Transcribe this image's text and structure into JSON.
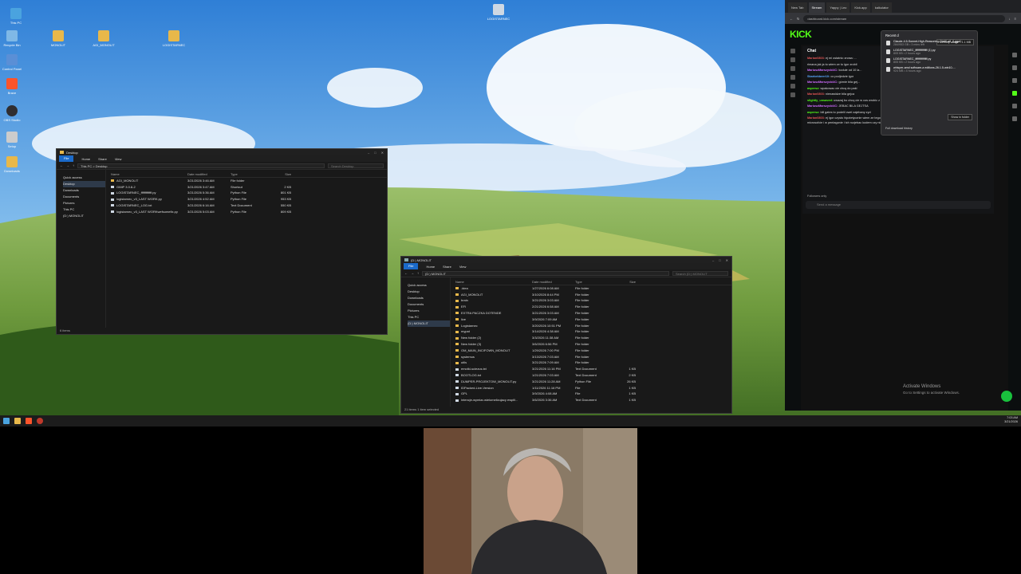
{
  "desktop": {
    "icons": [
      {
        "label": "This PC",
        "color": "#4aa3df"
      },
      {
        "label": "Recycle Bin",
        "color": "#7fb8e6"
      },
      {
        "label": "Control Panel",
        "color": "#5a8fd6"
      },
      {
        "label": "Brave",
        "color": "#fb542b"
      },
      {
        "label": "OBS Studio",
        "color": "#302e31"
      },
      {
        "label": "Setup",
        "color": "#cccccc"
      },
      {
        "label": "Downloads",
        "color": "#e8b84a"
      },
      {
        "label": "MONOLIT",
        "color": "#e8b84a"
      },
      {
        "label": "AGI_MONOLIT",
        "color": "#e8b84a"
      },
      {
        "label": "LOGISTARNEC",
        "color": "#e8b84a"
      },
      {
        "label": "LOGISTARNEC",
        "color": "#cfd8e3"
      }
    ]
  },
  "explorer_desktop": {
    "title": "Desktop",
    "ribbon": [
      "File",
      "Home",
      "Share",
      "View"
    ],
    "address": "This PC  >  Desktop",
    "search_placeholder": "Search Desktop",
    "nav": [
      "Quick access",
      "Desktop",
      "Downloads",
      "Documents",
      "Pictures",
      "This PC",
      "(D:) MONOLIT"
    ],
    "columns": [
      "Name",
      "Date modified",
      "Type",
      "Size"
    ],
    "rows": [
      {
        "name": "AGI_MONOLIT",
        "date": "3/21/2026 3:46 AM",
        "type": "File folder",
        "size": "",
        "kind": "folder"
      },
      {
        "name": "GIMP 3.0.8-2",
        "date": "3/21/2026 3:47 AM",
        "type": "Shortcut",
        "size": "2 KB",
        "kind": "doc"
      },
      {
        "name": "LOGISTARNEC_fffffffffffff.py",
        "date": "3/21/2026 5:36 AM",
        "type": "Python File",
        "size": "801 KB",
        "kind": "doc"
      },
      {
        "name": "logistarnec_v3_LAST WORK.py",
        "date": "3/21/2026 4:52 AM",
        "type": "Python File",
        "size": "953 KB",
        "kind": "doc"
      },
      {
        "name": "LOGISTARNEC_LOG.txt",
        "date": "3/21/2026 6:16 AM",
        "type": "Text Document",
        "size": "550 KB",
        "kind": "doc"
      },
      {
        "name": "logistarnec_v3_LAST WORKwefsomefix.py",
        "date": "3/21/2026 5:03 AM",
        "type": "Python File",
        "size": "809 KB",
        "kind": "doc"
      }
    ],
    "status": "6 items"
  },
  "explorer_monolit": {
    "title": "(D:) MONOLIT",
    "ribbon": [
      "File",
      "Home",
      "Share",
      "View"
    ],
    "address": "(D:) MONOLIT",
    "search_placeholder": "Search (D:) MONOLIT",
    "nav": [
      "Quick access",
      "Desktop",
      "Downloads",
      "Documents",
      "Pictures",
      "This PC",
      "(D:) MONOLIT"
    ],
    "columns": [
      "Name",
      "Date modified",
      "Type",
      "Size"
    ],
    "rows": [
      {
        "name": ".idea",
        "date": "1/27/2026 6:08 AM",
        "type": "File folder",
        "size": "",
        "kind": "folder"
      },
      {
        "name": "AGI_MONOLIT",
        "date": "3/10/2026 8:44 PM",
        "type": "File folder",
        "size": "",
        "kind": "folder"
      },
      {
        "name": "brain",
        "date": "3/21/2026 3:03 AM",
        "type": "File folder",
        "size": "",
        "kind": "folder"
      },
      {
        "name": "EFI",
        "date": "2/21/2026 6:58 AM",
        "type": "File folder",
        "size": "",
        "kind": "folder"
      },
      {
        "name": "EXTRA PACZKA DOTENDE",
        "date": "3/21/2026 3:03 AM",
        "type": "File folder",
        "size": "",
        "kind": "folder"
      },
      {
        "name": "live",
        "date": "3/9/2026 7:09 AM",
        "type": "File folder",
        "size": "",
        "kind": "folder"
      },
      {
        "name": "Logistarnec",
        "date": "3/20/2026 10:51 PM",
        "type": "File folder",
        "size": "",
        "kind": "folder"
      },
      {
        "name": "mypat",
        "date": "3/14/2026 4:38 AM",
        "type": "File folder",
        "size": "",
        "kind": "folder"
      },
      {
        "name": "New folder (2)",
        "date": "3/3/2026 11:38 AM",
        "type": "File folder",
        "size": "",
        "kind": "folder"
      },
      {
        "name": "New folder (3)",
        "date": "3/6/2026 6:56 PM",
        "type": "File folder",
        "size": "",
        "kind": "folder"
      },
      {
        "name": "OM_MAIN_INCIFOWN_MONOLIT",
        "date": "1/29/2026 7:00 PM",
        "type": "File folder",
        "size": "",
        "kind": "folder"
      },
      {
        "name": "systemus",
        "date": "3/13/2026 7:03 AM",
        "type": "File folder",
        "size": "",
        "kind": "folder"
      },
      {
        "name": "utils",
        "date": "3/21/2026 7:09 AM",
        "type": "File folder",
        "size": "",
        "kind": "folder"
      },
      {
        "name": "emotki-sciezus.txt",
        "date": "3/21/2026 11:16 PM",
        "type": "Text Document",
        "size": "1 KB",
        "kind": "doc"
      },
      {
        "name": "BOOTLOG.txt",
        "date": "1/21/2026 7:03 AM",
        "type": "Text Document",
        "size": "2 KB",
        "kind": "doc"
      },
      {
        "name": "DUMPER-PROJEKTOW_MONOLIT.py",
        "date": "3/21/2026 11:28 AM",
        "type": "Python File",
        "size": "26 KB",
        "kind": "doc"
      },
      {
        "name": "IDPacked-Live-Version",
        "date": "1/11/2026 11:16 PM",
        "type": "File",
        "size": "1 KB",
        "kind": "doc"
      },
      {
        "name": "GPL",
        "date": "3/9/2026 4:08 AM",
        "type": "File",
        "size": "1 KB",
        "kind": "doc"
      },
      {
        "name": "intencje-wymiar-wielomelizujacy ewplil...",
        "date": "3/6/2026 3:36 AM",
        "type": "Text Document",
        "size": "1 KB",
        "kind": "doc"
      }
    ],
    "status": "21 items    1 item selected"
  },
  "browser": {
    "tabs": [
      "New Tab",
      "Stream",
      "Yappy | Leo",
      "Kick.app",
      "kalkulator"
    ],
    "url": "dashboard.kick.com/stream",
    "logo": "KICK",
    "chat_title": "Chat",
    "followers_only": "Followers only",
    "send_placeholder": "Send a message",
    "messages": [
      {
        "user": "Marian0803:",
        "text": "ej mi ostatnio znowu ...",
        "color": "#e25555"
      },
      {
        "user": "",
        "text": "rimana jak ja to wiem ze to igor zrobil",
        "color": "#e25555"
      },
      {
        "user": "MariuszMarszycki4C:",
        "text": "kodule od 10 la...",
        "color": "#d06cff"
      },
      {
        "user": "Skarbekbeer10:",
        "text": "co podjedzie igor",
        "color": "#5aa8ff"
      },
      {
        "user": "MariuszMarszycki4C:",
        "text": "górnie bila gej...",
        "color": "#d06cff"
      },
      {
        "user": "aspersz:",
        "text": "wpakowac cie chcq do paki",
        "color": "#53fc18"
      },
      {
        "user": "Marian0803:",
        "text": "nienawidze bila gejca",
        "color": "#e25555"
      },
      {
        "user": "slightly_unsaved:",
        "text": "uwazaj bo chcq cie w cos wrobic z tym nadawaniem",
        "color": "#53fc18"
      },
      {
        "user": "MariuszMarszycki4C:",
        "text": "JEBAC BILA GEJTSA",
        "color": "#d06cff"
      },
      {
        "user": "aspersz:",
        "text": "bill gates to podelil cwel zajebany zyd",
        "color": "#53fc18"
      },
      {
        "user": "Marian0803:",
        "text": "ej igor czysto hipotetycznie wiem ze tego nie chcesz ale zalozmy jak bys sie wkurwil dalbys rade wyjebac prad w microsofcie i w pentagonie i tch rozjebac kodem czy nie jak bys to zrobil pulbikami znak zapytania",
        "color": "#e25555"
      }
    ]
  },
  "downloads": {
    "title": "Recent d",
    "memory": "Memory usage: 71.1 MB",
    "items": [
      {
        "name": "Claude-4.5-Sonnet-High-Reasoning-Distill-q8_0.gguf",
        "meta": "284/953 GB • 3 mins left"
      },
      {
        "name": "LOGISTARNEC_ffffffffffffffff (1).py",
        "meta": "805 KB • 2 hours ago"
      },
      {
        "name": "LOGISTARNEC_ffffffffffffffff.py",
        "meta": "805 KB • 2 hours ago"
      },
      {
        "name": "whisper-amd software-a editions-26.1.5-win10-...",
        "meta": "924 MB • 4 hours ago"
      }
    ],
    "tooltip": "Show in folder",
    "full_history": "Full download history"
  },
  "taskbar": {
    "clock_time": "7:03 AM",
    "clock_date": "3/21/2026"
  },
  "watermark": {
    "line1": "Activate Windows",
    "line2": "Go to Settings to activate Windows."
  }
}
